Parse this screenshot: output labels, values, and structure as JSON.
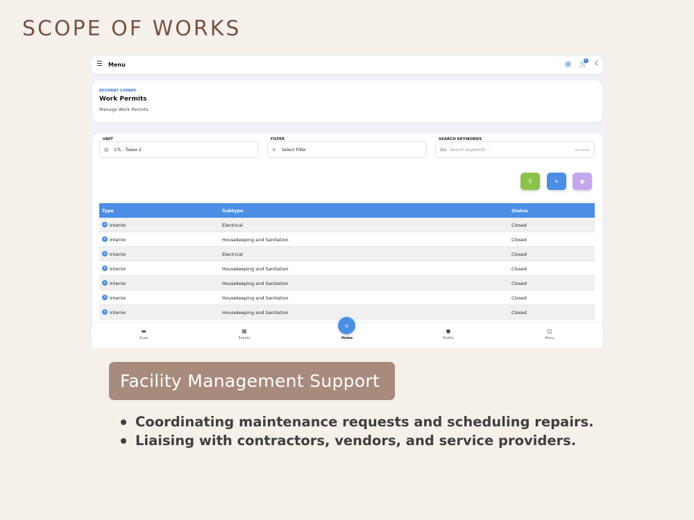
{
  "slide": {
    "title": "SCOPE OF WORKS",
    "section_heading": "Facility Management Support",
    "bullets": [
      "Coordinating maintenance requests and scheduling repairs.",
      "Liaising with contractors, vendors, and service providers."
    ]
  },
  "app": {
    "topbar": {
      "menu_label": "Menu",
      "cart_count": "0",
      "icons": [
        "hamburger-icon",
        "at-sign-icon",
        "cart-icon",
        "moon-icon"
      ]
    },
    "header": {
      "breadcrumb": "RESIDENT CORNER",
      "title": "Work Permits",
      "subtitle": "Manage Work Permits"
    },
    "filters": {
      "unit": {
        "label": "UNIT",
        "value": "17L - Tower-2"
      },
      "filter": {
        "label": "FILTER",
        "value": "Select Filter"
      },
      "search": {
        "label": "SEARCH KEYWORDS",
        "placeholder": "Search keywords ...",
        "hint": "(several)"
      }
    },
    "actions": [
      {
        "name": "search",
        "glyph": "⚲",
        "color": "#8bc34a"
      },
      {
        "name": "add",
        "glyph": "+",
        "color": "#4a8ee6"
      },
      {
        "name": "view",
        "glyph": "◉",
        "color": "#c5a6f0"
      }
    ],
    "table": {
      "columns": [
        "Type",
        "Subtype",
        "Status"
      ],
      "rows": [
        {
          "type": "Interior",
          "subtype": "Electrical",
          "status": "Closed"
        },
        {
          "type": "Interior",
          "subtype": "Housekeeping and Sanitation",
          "status": "Closed"
        },
        {
          "type": "Interior",
          "subtype": "Electrical",
          "status": "Closed"
        },
        {
          "type": "Interior",
          "subtype": "Housekeeping and Sanitation",
          "status": "Closed"
        },
        {
          "type": "Interior",
          "subtype": "Housekeeping and Sanitation",
          "status": "Closed"
        },
        {
          "type": "Interior",
          "subtype": "Housekeeping and Sanitation",
          "status": "Closed"
        },
        {
          "type": "Interior",
          "subtype": "Housekeeping and Sanitation",
          "status": "Closed"
        }
      ]
    },
    "bottom_nav": {
      "items": [
        {
          "label": "Dues",
          "icon": "wallet-icon"
        },
        {
          "label": "Events",
          "icon": "calendar-icon"
        },
        {
          "label": "Home",
          "icon": "home-icon"
        },
        {
          "label": "Profile",
          "icon": "user-icon"
        },
        {
          "label": "Menu",
          "icon": "sidebar-icon"
        }
      ]
    },
    "colors": {
      "accent": "#4a8ee6",
      "slide_title": "#7a5340",
      "pill": "#a98b7d",
      "background": "#f5f0ea"
    }
  }
}
